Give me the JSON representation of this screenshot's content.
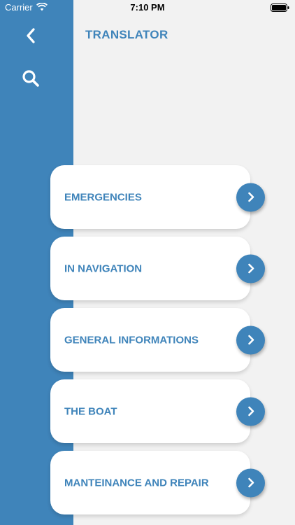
{
  "status_bar": {
    "carrier": "Carrier",
    "time": "7:10 PM",
    "wifi_icon": "wifi-icon",
    "battery_icon": "battery-icon"
  },
  "nav": {
    "back_icon": "chevron-left-icon",
    "search_icon": "search-icon"
  },
  "header": {
    "title": "TRANSLATOR"
  },
  "colors": {
    "accent": "#3f84ba",
    "background": "#f2f2f2",
    "card": "#ffffff"
  },
  "menu": {
    "items": [
      {
        "label": "EMERGENCIES",
        "icon": "chevron-right-icon"
      },
      {
        "label": "IN NAVIGATION",
        "icon": "chevron-right-icon"
      },
      {
        "label": "GENERAL INFORMATIONS",
        "icon": "chevron-right-icon"
      },
      {
        "label": "THE BOAT",
        "icon": "chevron-right-icon"
      },
      {
        "label": "MANTEINANCE AND REPAIR",
        "icon": "chevron-right-icon"
      }
    ]
  }
}
